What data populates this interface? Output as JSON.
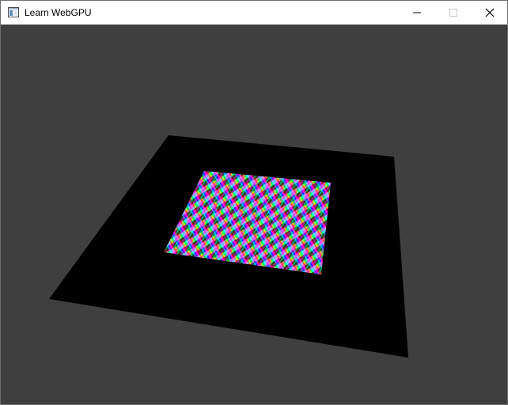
{
  "window": {
    "title": "Learn WebGPU",
    "app_icon": "window-app-icon",
    "controls": {
      "minimize_icon": "minimize-icon",
      "maximize_icon": "maximize-icon",
      "close_icon": "close-icon"
    }
  },
  "viewport": {
    "clear_color": "#3f3f3f",
    "plane_color": "#000000",
    "texture": {
      "pattern": "rainbow-gradient-checker",
      "colors": [
        "#ff0000",
        "#ffff00",
        "#00ff00",
        "#00ffff",
        "#0000ff",
        "#ff00ff",
        "#ffffff",
        "#000000"
      ]
    }
  }
}
